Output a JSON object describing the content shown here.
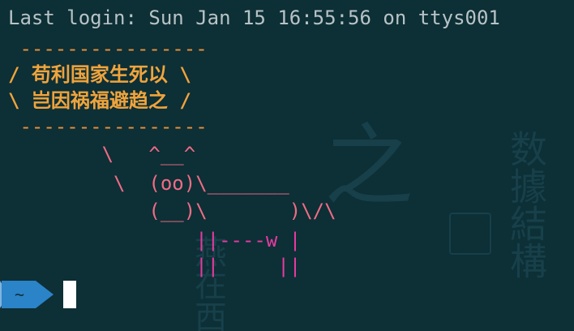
{
  "terminal": {
    "last_login": "Last login: Sun Jan 15 16:55:56 on ttys001",
    "cowsay": {
      "border_top": " ----------------",
      "line1": "/ 苟利国家生死以 \\",
      "line2": "\\ 岂因祸福避趋之 /",
      "border_bottom": " ----------------",
      "cow1": "        \\   ^__^",
      "cow2": "         \\  (oo)\\_______",
      "cow3": "            (__)\\       )\\/\\",
      "cow4": "                ||----w |",
      "cow5": "                ||     ||"
    },
    "prompt": {
      "dir": "~"
    },
    "watermark": {
      "right_col": "数據結構",
      "left_col": "燕在西",
      "center_glyph": "之"
    }
  },
  "colors": {
    "background": "#0d2f36",
    "login_text": "#b7c3c6",
    "bubble": "#f0a43c",
    "cow_face": "#f06c85",
    "cow_legs": "#e83aa0",
    "prompt_bg": "#2b83c8"
  }
}
